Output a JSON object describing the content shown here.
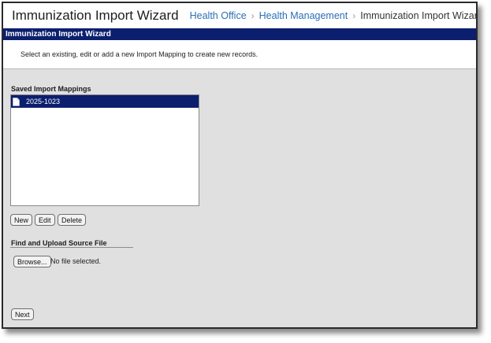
{
  "header": {
    "title": "Immunization Import Wizard",
    "breadcrumb": [
      "Health Office",
      "Health Management"
    ],
    "current": "Immunization Import Wizard"
  },
  "wizard": {
    "title": "Immunization Import Wizard",
    "instructions": "Select an existing, edit or add a new Import Mapping to create new records."
  },
  "mappings": {
    "label": "Saved Import Mappings",
    "items": [
      "2025-1023"
    ],
    "selected": "2025-1023",
    "new_label": "New",
    "edit_label": "Edit",
    "delete_label": "Delete"
  },
  "upload": {
    "label": "Find and Upload Source File",
    "browse_label": "Browse...",
    "status": "No file selected."
  },
  "next_label": "Next",
  "colors": {
    "titlebar": "#0b1f6e",
    "selected_row": "#0b1f6e",
    "link": "#2a6fb5",
    "panel_bg": "#e0e0e0"
  }
}
